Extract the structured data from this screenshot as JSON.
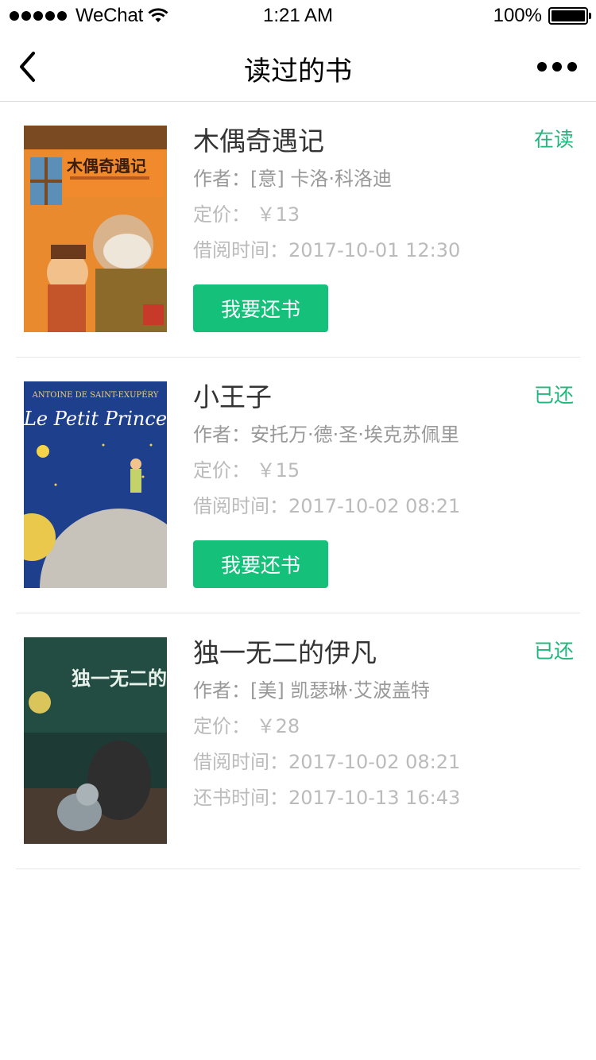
{
  "status_bar": {
    "carrier": "WeChat",
    "time": "1:21 AM",
    "battery": "100%"
  },
  "nav": {
    "title": "读过的书"
  },
  "books": [
    {
      "title": "木偶奇遇记",
      "author": "作者：[意] 卡洛·科洛迪",
      "price": "定价：  ￥13",
      "borrow_time": "借阅时间：2017-10-01   12:30",
      "status": "在读",
      "button": "我要还书",
      "cover_title": "木偶奇遇记"
    },
    {
      "title": "小王子",
      "author": "作者：安托万·德·圣·埃克苏佩里",
      "price": "定价：  ￥15",
      "borrow_time": "借阅时间：2017-10-02   08:21",
      "status": "已还",
      "button": "我要还书",
      "cover_title": "Le Petit Prince",
      "cover_author": "ANTOINE DE SAINT-EXUPÉRY"
    },
    {
      "title": "独一无二的伊凡",
      "author": "作者：[美] 凯瑟琳·艾波盖特",
      "price": "定价：  ￥28",
      "borrow_time": "借阅时间：2017-10-02   08:21",
      "return_time": "还书时间：2017-10-13   16:43",
      "status": "已还",
      "cover_title": "独一无二的伊凡"
    }
  ],
  "colors": {
    "accent": "#14c07a",
    "status_text": "#1fb77b"
  }
}
